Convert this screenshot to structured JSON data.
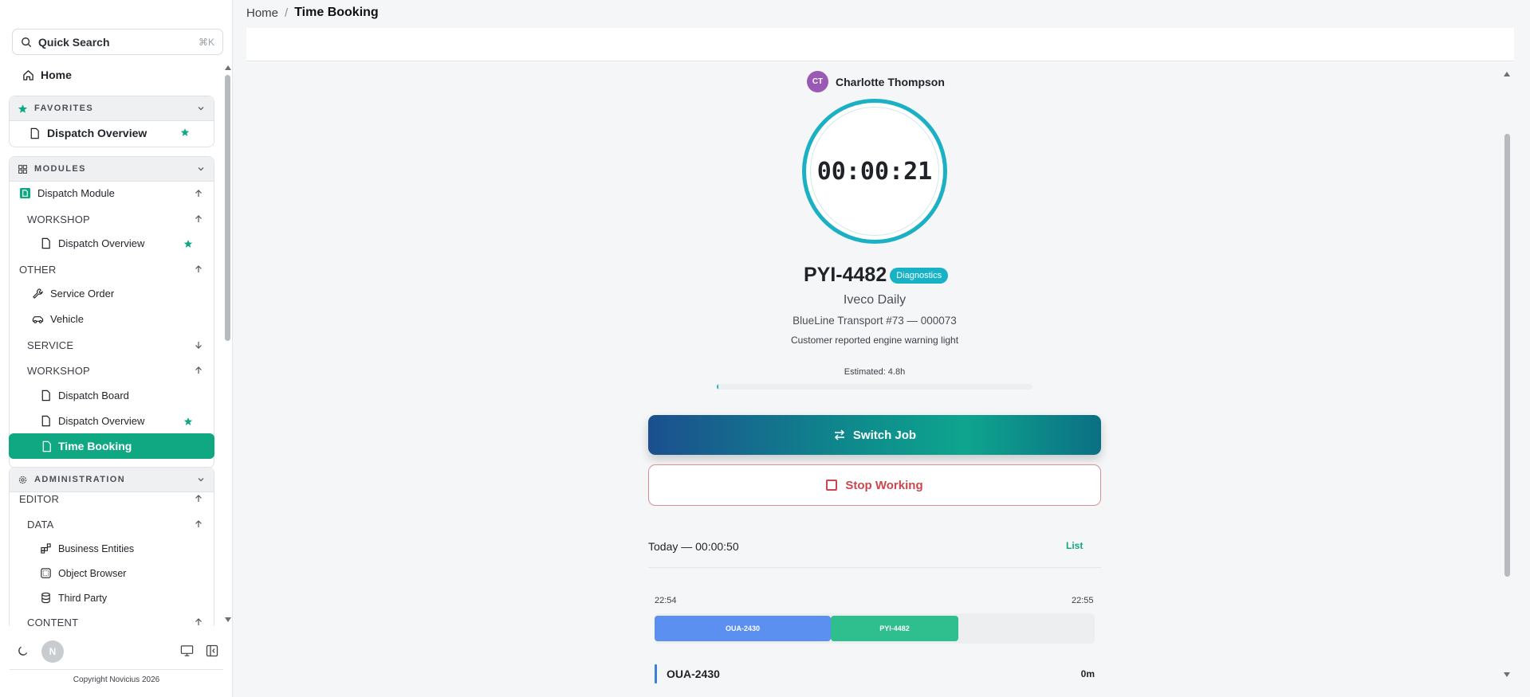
{
  "sidebar": {
    "search": {
      "label": "Quick Search",
      "shortcut": "⌘K"
    },
    "home": "Home",
    "favorites": {
      "title": "FAVORITES",
      "items": [
        {
          "label": "Dispatch Overview"
        }
      ]
    },
    "modules": {
      "title": "MODULES",
      "dispatch_module": "Dispatch Module",
      "workshop_1": "WORKSHOP",
      "workshop_1_item": "Dispatch Overview",
      "other": "OTHER",
      "service_order": "Service Order",
      "vehicle": "Vehicle",
      "service": "SERVICE",
      "workshop_2": "WORKSHOP",
      "dispatch_board": "Dispatch Board",
      "dispatch_overview_2": "Dispatch Overview",
      "time_booking": "Time Booking"
    },
    "administration": {
      "title": "ADMINISTRATION",
      "editor": "EDITOR",
      "data": "DATA",
      "business_entities": "Business Entities",
      "object_browser": "Object Browser",
      "third_party": "Third Party",
      "content": "CONTENT"
    },
    "footer": {
      "avatar_initial": "N",
      "copyright": "Copyright Novicius 2026"
    }
  },
  "breadcrumb": {
    "home": "Home",
    "separator": "/",
    "current": "Time Booking"
  },
  "user": {
    "initials": "CT",
    "name": "Charlotte Thompson"
  },
  "timer": {
    "value": "00:00:21"
  },
  "job": {
    "plate": "PYI-4482",
    "badge": "Diagnostics",
    "model": "Iveco Daily",
    "customer": "BlueLine Transport #73 — 000073",
    "description": "Customer reported engine warning light",
    "estimated": "Estimated: 4.8h",
    "progress_fraction": 0.004
  },
  "actions": {
    "switch_job": "Switch Job",
    "stop_working": "Stop Working"
  },
  "today": {
    "summary": "Today — 00:00:50",
    "list_link": "List",
    "timeline_start": "22:54",
    "timeline_end": "22:55",
    "segments": [
      {
        "label": "OUA-2430",
        "fraction": 0.4
      },
      {
        "label": "PYI-4482",
        "fraction": 0.29
      }
    ],
    "entries": [
      {
        "code": "OUA-2430",
        "duration": "0m"
      }
    ]
  },
  "colors": {
    "accent": "#0fa882",
    "timer_ring": "#1cb0c5",
    "stop": "#c9474f",
    "segment_a": "#5b8ff0",
    "segment_b": "#2fbf8e"
  }
}
